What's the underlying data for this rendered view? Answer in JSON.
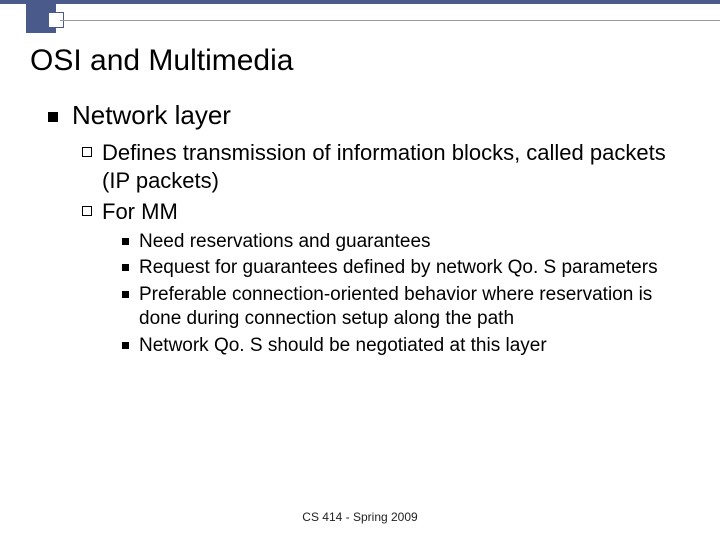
{
  "title": "OSI and Multimedia",
  "l1": {
    "label": "Network layer"
  },
  "l2a": {
    "prefix": "Defines ",
    "rest": "transmission of information blocks, called packets (IP packets)"
  },
  "l2b": {
    "label": "For MM"
  },
  "l3": {
    "a": {
      "pre": "Need ",
      "em": "reservations and guarantees",
      "post": ""
    },
    "b": {
      "pre": "Request for guarantees defined by ",
      "em": "network Qo. S parameters",
      "post": ""
    },
    "c": {
      "pre": "Preferable ",
      "em": "connection-oriented",
      "post": " behavior where reservation is done during connection setup along the path"
    },
    "d": {
      "pre": "Network Qo. S should be ",
      "em": "negotiated",
      "post": " at this layer"
    }
  },
  "footer": "CS 414 - Spring 2009"
}
